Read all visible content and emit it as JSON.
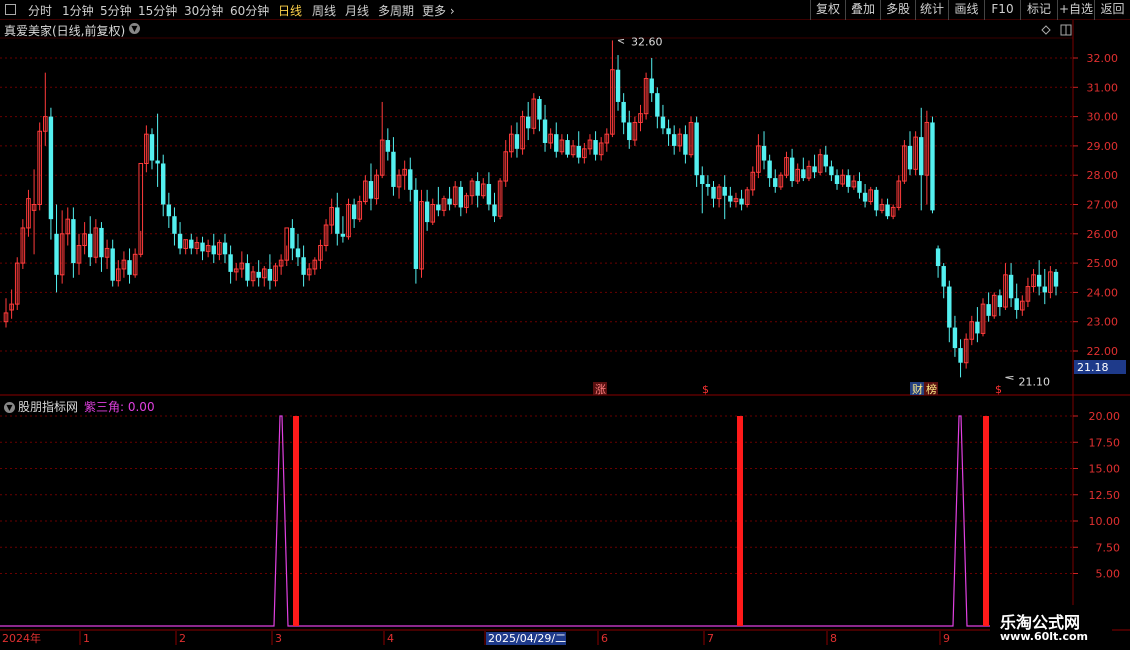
{
  "toolbar": {
    "periods": [
      "分时",
      "1分钟",
      "5分钟",
      "15分钟",
      "30分钟",
      "60分钟",
      "日线",
      "周线",
      "月线",
      "多周期",
      "更多"
    ],
    "active_period": "日线",
    "right_buttons": [
      "复权",
      "叠加",
      "多股",
      "统计",
      "画线",
      "F10",
      "标记",
      "+自选",
      "返回"
    ]
  },
  "main_panel": {
    "title": "真爱美家(日线,前复权)",
    "y_ticks": [
      "32.00",
      "31.00",
      "30.00",
      "29.00",
      "28.00",
      "27.00",
      "26.00",
      "25.00",
      "24.00",
      "23.00",
      "22.00"
    ],
    "current_price": "21.18",
    "high_label": "32.60",
    "low_label": "21.10",
    "markers": [
      "涨",
      "$",
      "财",
      "榜",
      "$"
    ]
  },
  "indicator_panel": {
    "title": "股朋指标网",
    "value_label": "紫三角: 0.00",
    "y_ticks": [
      "20.00",
      "17.50",
      "15.00",
      "12.50",
      "10.00",
      "7.50",
      "5.00"
    ]
  },
  "x_axis": {
    "labels": [
      "2024年",
      "1",
      "2",
      "3",
      "4",
      "2025/04/29/二",
      "6",
      "7",
      "8",
      "9"
    ]
  },
  "watermark": {
    "line1": "乐淘公式网",
    "line2": "www.60lt.com"
  },
  "colors": {
    "up": "#ff3b3b",
    "down": "#54f0f0",
    "grid": "#6a0000",
    "purple": "#e040e0",
    "red_bar": "#ff1a1a",
    "active": "#ffd24a"
  },
  "chart_data": {
    "type": "candlestick",
    "y_range": [
      21.5,
      32.7
    ],
    "candles": [
      [
        23.0,
        23.8,
        23.3,
        22.8
      ],
      [
        23.4,
        24.1,
        23.6,
        23.1
      ],
      [
        23.6,
        25.2,
        25.0,
        23.4
      ],
      [
        25.0,
        26.5,
        26.2,
        24.8
      ],
      [
        26.2,
        27.5,
        27.2,
        25.9
      ],
      [
        26.8,
        28.2,
        27.0,
        25.3
      ],
      [
        27.0,
        29.8,
        29.5,
        26.8
      ],
      [
        29.5,
        31.5,
        30.0,
        29.0
      ],
      [
        30.0,
        30.3,
        26.5,
        25.8
      ],
      [
        26.0,
        27.0,
        24.6,
        24.0
      ],
      [
        24.6,
        26.8,
        26.0,
        24.3
      ],
      [
        26.0,
        26.9,
        26.5,
        25.6
      ],
      [
        26.5,
        26.9,
        25.0,
        24.5
      ],
      [
        25.0,
        26.0,
        25.6,
        24.6
      ],
      [
        25.6,
        26.4,
        26.0,
        25.3
      ],
      [
        26.0,
        26.6,
        25.2,
        24.9
      ],
      [
        25.2,
        26.5,
        26.2,
        25.0
      ],
      [
        26.2,
        26.4,
        25.2,
        24.7
      ],
      [
        25.2,
        25.8,
        25.5,
        24.8
      ],
      [
        25.5,
        25.8,
        24.4,
        24.2
      ],
      [
        24.4,
        25.1,
        24.8,
        24.2
      ],
      [
        24.8,
        25.4,
        25.1,
        24.5
      ],
      [
        25.1,
        25.5,
        24.6,
        24.3
      ],
      [
        24.6,
        25.5,
        25.3,
        24.5
      ],
      [
        25.3,
        26.1,
        28.4,
        25.2
      ],
      [
        28.4,
        29.7,
        29.4,
        28.1
      ],
      [
        29.4,
        29.6,
        28.5,
        28.2
      ],
      [
        28.5,
        30.1,
        28.4,
        27.6
      ],
      [
        28.4,
        28.7,
        27.0,
        26.6
      ],
      [
        27.0,
        27.4,
        26.6,
        26.2
      ],
      [
        26.6,
        26.9,
        26.0,
        25.6
      ],
      [
        26.0,
        26.4,
        25.5,
        25.3
      ],
      [
        25.5,
        25.8,
        25.8,
        25.3
      ],
      [
        25.8,
        26.0,
        25.5,
        25.3
      ],
      [
        25.5,
        25.9,
        25.7,
        25.3
      ],
      [
        25.7,
        25.9,
        25.4,
        25.1
      ],
      [
        25.4,
        25.8,
        25.6,
        25.2
      ],
      [
        25.6,
        26.0,
        25.3,
        25.0
      ],
      [
        25.3,
        25.8,
        25.7,
        25.1
      ],
      [
        25.7,
        26.0,
        25.3,
        25.0
      ],
      [
        25.3,
        25.6,
        24.7,
        24.3
      ],
      [
        24.7,
        25.0,
        24.8,
        24.4
      ],
      [
        24.8,
        25.4,
        25.0,
        24.5
      ],
      [
        25.0,
        25.3,
        24.4,
        24.2
      ],
      [
        24.4,
        24.9,
        24.7,
        24.2
      ],
      [
        24.7,
        25.1,
        24.5,
        24.2
      ],
      [
        24.5,
        24.9,
        24.8,
        24.2
      ],
      [
        24.8,
        25.3,
        24.4,
        24.1
      ],
      [
        24.4,
        25.0,
        24.9,
        24.2
      ],
      [
        24.9,
        25.3,
        25.1,
        24.6
      ],
      [
        25.1,
        25.6,
        26.2,
        24.9
      ],
      [
        26.2,
        26.5,
        25.5,
        25.1
      ],
      [
        25.5,
        26.0,
        25.2,
        24.9
      ],
      [
        25.2,
        25.6,
        24.6,
        24.2
      ],
      [
        24.6,
        25.0,
        24.8,
        24.4
      ],
      [
        24.8,
        25.2,
        25.1,
        24.6
      ],
      [
        25.1,
        25.8,
        25.6,
        24.8
      ],
      [
        25.6,
        26.5,
        26.3,
        25.4
      ],
      [
        26.3,
        27.2,
        26.9,
        26.0
      ],
      [
        26.9,
        27.4,
        26.0,
        25.6
      ],
      [
        26.0,
        26.6,
        25.9,
        25.7
      ],
      [
        25.9,
        27.2,
        27.0,
        25.8
      ],
      [
        27.0,
        27.2,
        26.5,
        26.2
      ],
      [
        26.5,
        27.3,
        27.1,
        26.4
      ],
      [
        27.1,
        28.0,
        27.8,
        27.0
      ],
      [
        27.8,
        28.4,
        27.2,
        26.8
      ],
      [
        27.2,
        28.2,
        28.0,
        27.0
      ],
      [
        28.0,
        30.5,
        29.2,
        27.9
      ],
      [
        29.2,
        29.6,
        28.8,
        28.5
      ],
      [
        28.8,
        29.3,
        27.6,
        27.3
      ],
      [
        27.6,
        28.2,
        28.0,
        27.2
      ],
      [
        28.0,
        28.5,
        28.2,
        27.5
      ],
      [
        28.2,
        28.6,
        27.5,
        27.1
      ],
      [
        27.5,
        27.9,
        24.8,
        24.3
      ],
      [
        24.8,
        27.5,
        27.1,
        24.5
      ],
      [
        27.1,
        27.5,
        26.4,
        26.1
      ],
      [
        26.4,
        27.2,
        27.0,
        26.3
      ],
      [
        27.0,
        27.6,
        26.8,
        26.6
      ],
      [
        26.8,
        27.3,
        27.2,
        26.6
      ],
      [
        27.2,
        27.6,
        27.0,
        26.8
      ],
      [
        27.0,
        27.8,
        27.6,
        26.9
      ],
      [
        27.6,
        27.8,
        26.9,
        26.6
      ],
      [
        26.9,
        27.4,
        27.3,
        26.7
      ],
      [
        27.3,
        27.9,
        27.8,
        27.0
      ],
      [
        27.8,
        28.1,
        27.3,
        26.9
      ],
      [
        27.3,
        27.9,
        27.7,
        27.2
      ],
      [
        27.7,
        28.1,
        27.0,
        26.8
      ],
      [
        27.0,
        27.4,
        26.6,
        26.4
      ],
      [
        26.6,
        27.9,
        27.8,
        26.5
      ],
      [
        27.8,
        29.2,
        28.8,
        27.6
      ],
      [
        28.8,
        29.7,
        29.4,
        28.6
      ],
      [
        29.4,
        29.8,
        28.9,
        28.6
      ],
      [
        28.9,
        30.2,
        30.0,
        28.7
      ],
      [
        30.0,
        30.5,
        29.6,
        29.2
      ],
      [
        29.6,
        30.8,
        30.6,
        29.4
      ],
      [
        30.6,
        30.7,
        29.9,
        29.5
      ],
      [
        29.9,
        30.4,
        29.1,
        28.8
      ],
      [
        29.1,
        29.6,
        29.4,
        28.9
      ],
      [
        29.4,
        29.8,
        28.8,
        28.6
      ],
      [
        28.8,
        29.4,
        29.2,
        28.7
      ],
      [
        29.2,
        29.4,
        28.7,
        28.6
      ],
      [
        28.7,
        29.2,
        29.0,
        28.6
      ],
      [
        29.0,
        29.5,
        28.6,
        28.4
      ],
      [
        28.6,
        29.1,
        28.9,
        28.4
      ],
      [
        28.9,
        29.4,
        29.2,
        28.7
      ],
      [
        29.2,
        29.5,
        28.7,
        28.5
      ],
      [
        28.7,
        29.3,
        29.1,
        28.5
      ],
      [
        29.1,
        29.6,
        29.4,
        28.8
      ],
      [
        29.4,
        32.6,
        31.6,
        29.3
      ],
      [
        31.6,
        32.1,
        30.5,
        30.2
      ],
      [
        30.5,
        30.8,
        29.8,
        29.4
      ],
      [
        29.8,
        30.2,
        29.2,
        28.9
      ],
      [
        29.2,
        30.0,
        29.8,
        29.0
      ],
      [
        29.8,
        30.4,
        30.1,
        29.5
      ],
      [
        30.1,
        31.5,
        31.3,
        29.9
      ],
      [
        31.3,
        32.0,
        30.8,
        30.5
      ],
      [
        30.8,
        31.0,
        30.0,
        29.6
      ],
      [
        30.0,
        30.4,
        29.6,
        29.4
      ],
      [
        29.6,
        29.9,
        29.4,
        29.0
      ],
      [
        29.4,
        29.7,
        29.0,
        28.7
      ],
      [
        29.0,
        29.6,
        29.4,
        28.8
      ],
      [
        29.4,
        29.7,
        28.7,
        28.4
      ],
      [
        28.7,
        30.0,
        29.8,
        28.6
      ],
      [
        29.8,
        30.0,
        28.0,
        27.6
      ],
      [
        28.0,
        28.3,
        27.7,
        26.7
      ],
      [
        27.7,
        28.0,
        27.6,
        27.3
      ],
      [
        27.6,
        27.8,
        27.2,
        26.9
      ],
      [
        27.2,
        27.7,
        27.6,
        26.9
      ],
      [
        27.6,
        28.0,
        27.3,
        26.5
      ],
      [
        27.3,
        27.6,
        27.1,
        26.9
      ],
      [
        27.1,
        27.4,
        27.2,
        26.9
      ],
      [
        27.2,
        27.5,
        27.0,
        26.8
      ],
      [
        27.0,
        27.6,
        27.5,
        26.9
      ],
      [
        27.5,
        28.3,
        28.1,
        27.3
      ],
      [
        28.1,
        29.4,
        29.0,
        27.9
      ],
      [
        29.0,
        29.5,
        28.5,
        28.2
      ],
      [
        28.5,
        28.7,
        27.9,
        27.6
      ],
      [
        27.9,
        28.2,
        27.6,
        27.4
      ],
      [
        27.6,
        28.1,
        28.0,
        27.5
      ],
      [
        28.0,
        28.8,
        28.6,
        27.9
      ],
      [
        28.6,
        28.9,
        27.8,
        27.6
      ],
      [
        27.8,
        28.4,
        28.2,
        27.7
      ],
      [
        28.2,
        28.6,
        27.9,
        27.8
      ],
      [
        27.9,
        28.5,
        28.3,
        27.8
      ],
      [
        28.3,
        28.7,
        28.1,
        27.9
      ],
      [
        28.1,
        28.9,
        28.7,
        28.0
      ],
      [
        28.7,
        29.0,
        28.3,
        28.1
      ],
      [
        28.3,
        28.5,
        28.0,
        27.8
      ],
      [
        28.0,
        28.2,
        27.7,
        27.5
      ],
      [
        27.7,
        28.2,
        28.0,
        27.6
      ],
      [
        28.0,
        28.2,
        27.6,
        27.4
      ],
      [
        27.6,
        28.0,
        27.8,
        27.5
      ],
      [
        27.8,
        28.1,
        27.4,
        27.2
      ],
      [
        27.4,
        27.7,
        27.1,
        26.9
      ],
      [
        27.1,
        27.6,
        27.5,
        27.0
      ],
      [
        27.5,
        27.6,
        26.8,
        26.6
      ],
      [
        26.8,
        27.2,
        27.0,
        26.7
      ],
      [
        27.0,
        27.2,
        26.6,
        26.5
      ],
      [
        26.6,
        27.0,
        26.9,
        26.5
      ],
      [
        26.9,
        28.0,
        27.8,
        26.8
      ],
      [
        27.8,
        29.2,
        29.0,
        27.7
      ],
      [
        29.0,
        29.5,
        28.2,
        28.0
      ],
      [
        28.2,
        29.5,
        29.3,
        28.0
      ],
      [
        29.3,
        30.3,
        28.0,
        26.8
      ],
      [
        28.0,
        30.2,
        29.8,
        27.0
      ],
      [
        29.8,
        30.0,
        26.8,
        26.7
      ],
      [
        25.5,
        25.6,
        24.9,
        24.5
      ],
      [
        24.9,
        25.0,
        24.2,
        23.8
      ],
      [
        24.2,
        24.4,
        22.8,
        22.3
      ],
      [
        22.8,
        23.2,
        22.1,
        21.8
      ],
      [
        22.1,
        22.4,
        21.6,
        21.1
      ],
      [
        21.6,
        22.6,
        22.4,
        21.4
      ],
      [
        22.4,
        23.2,
        23.0,
        22.2
      ],
      [
        23.0,
        23.5,
        22.6,
        22.3
      ],
      [
        22.6,
        23.8,
        23.6,
        22.5
      ],
      [
        23.6,
        24.0,
        23.2,
        23.0
      ],
      [
        23.2,
        24.0,
        23.9,
        23.1
      ],
      [
        23.9,
        24.1,
        23.5,
        23.2
      ],
      [
        23.5,
        25.0,
        24.6,
        23.4
      ],
      [
        24.6,
        25.0,
        23.8,
        23.5
      ],
      [
        23.8,
        24.3,
        23.4,
        23.1
      ],
      [
        23.4,
        23.9,
        23.7,
        23.2
      ],
      [
        23.7,
        24.5,
        24.2,
        23.5
      ],
      [
        24.2,
        24.8,
        24.6,
        24.0
      ],
      [
        24.6,
        25.1,
        24.2,
        23.9
      ],
      [
        24.2,
        24.8,
        24.0,
        23.6
      ],
      [
        24.0,
        24.9,
        24.7,
        23.8
      ],
      [
        24.7,
        24.8,
        24.2,
        23.9
      ]
    ],
    "indicator": {
      "y_range": [
        0,
        20
      ],
      "purple_peaks": [
        [
          277,
          285
        ],
        [
          956,
          964
        ]
      ],
      "red_bars": [
        296,
        740,
        986
      ]
    }
  }
}
